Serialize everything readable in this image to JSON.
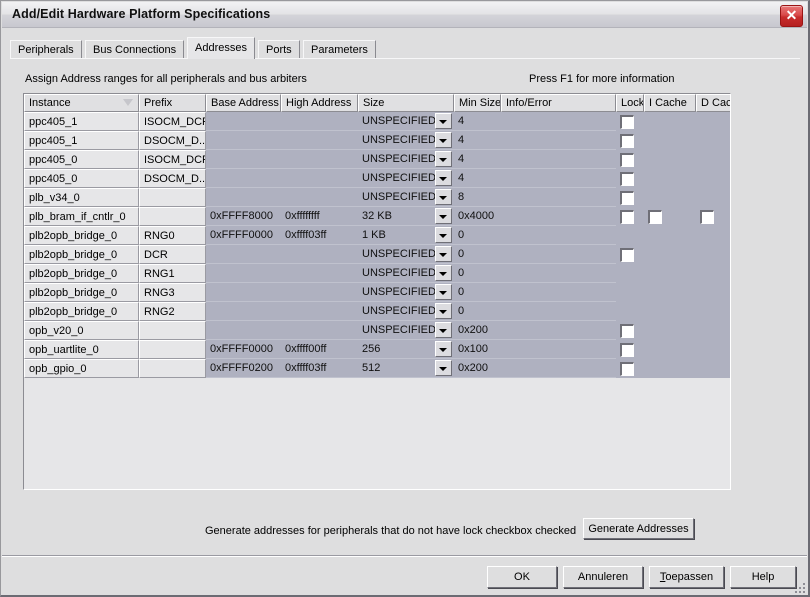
{
  "window": {
    "title": "Add/Edit Hardware Platform Specifications",
    "close_icon": "close-icon",
    "close_glyph": "✕"
  },
  "tabs": [
    {
      "label": "Peripherals",
      "selected": false
    },
    {
      "label": "Bus Connections",
      "selected": false
    },
    {
      "label": "Addresses",
      "selected": true
    },
    {
      "label": "Ports",
      "selected": false
    },
    {
      "label": "Parameters",
      "selected": false
    }
  ],
  "panel": {
    "assign_label": "Assign Address ranges for all peripherals and bus arbiters",
    "help_hint": "Press F1 for more information"
  },
  "table": {
    "columns": [
      {
        "label": "Instance",
        "sorted": true
      },
      {
        "label": "Prefix",
        "sorted": false
      },
      {
        "label": "Base Address",
        "sorted": false
      },
      {
        "label": "High Address",
        "sorted": false
      },
      {
        "label": "Size",
        "sorted": false
      },
      {
        "label": "Min Size",
        "sorted": false
      },
      {
        "label": "Info/Error",
        "sorted": false
      },
      {
        "label": "Lock",
        "sorted": false
      },
      {
        "label": "I Cache",
        "sorted": false
      },
      {
        "label": "D Cache",
        "sorted": false
      }
    ],
    "rows": [
      {
        "instance": "ppc405_1",
        "prefix": "ISOCM_DCR",
        "base": "",
        "high": "",
        "size": "UNSPECIFIED",
        "min_size": "4",
        "info": "",
        "lock": true,
        "icache": false,
        "dcache": false
      },
      {
        "instance": "ppc405_1",
        "prefix": "DSOCM_D...",
        "base": "",
        "high": "",
        "size": "UNSPECIFIED",
        "min_size": "4",
        "info": "",
        "lock": true,
        "icache": false,
        "dcache": false
      },
      {
        "instance": "ppc405_0",
        "prefix": "ISOCM_DCR",
        "base": "",
        "high": "",
        "size": "UNSPECIFIED",
        "min_size": "4",
        "info": "",
        "lock": true,
        "icache": false,
        "dcache": false
      },
      {
        "instance": "ppc405_0",
        "prefix": "DSOCM_D...",
        "base": "",
        "high": "",
        "size": "UNSPECIFIED",
        "min_size": "4",
        "info": "",
        "lock": true,
        "icache": false,
        "dcache": false
      },
      {
        "instance": "plb_v34_0",
        "prefix": "",
        "base": "",
        "high": "",
        "size": "UNSPECIFIED",
        "min_size": "8",
        "info": "",
        "lock": true,
        "icache": false,
        "dcache": false
      },
      {
        "instance": "plb_bram_if_cntlr_0",
        "prefix": "",
        "base": "0xFFFF8000",
        "high": "0xffffffff",
        "size": "32 KB",
        "min_size": "0x4000",
        "info": "",
        "lock": true,
        "icache": true,
        "dcache": true
      },
      {
        "instance": "plb2opb_bridge_0",
        "prefix": "RNG0",
        "base": "0xFFFF0000",
        "high": "0xffff03ff",
        "size": "1 KB",
        "min_size": "0",
        "info": "",
        "lock": false,
        "icache": false,
        "dcache": false
      },
      {
        "instance": "plb2opb_bridge_0",
        "prefix": "DCR",
        "base": "",
        "high": "",
        "size": "UNSPECIFIED",
        "min_size": "0",
        "info": "",
        "lock": true,
        "icache": false,
        "dcache": false
      },
      {
        "instance": "plb2opb_bridge_0",
        "prefix": "RNG1",
        "base": "",
        "high": "",
        "size": "UNSPECIFIED",
        "min_size": "0",
        "info": "",
        "lock": false,
        "icache": false,
        "dcache": false
      },
      {
        "instance": "plb2opb_bridge_0",
        "prefix": "RNG3",
        "base": "",
        "high": "",
        "size": "UNSPECIFIED",
        "min_size": "0",
        "info": "",
        "lock": false,
        "icache": false,
        "dcache": false
      },
      {
        "instance": "plb2opb_bridge_0",
        "prefix": "RNG2",
        "base": "",
        "high": "",
        "size": "UNSPECIFIED",
        "min_size": "0",
        "info": "",
        "lock": false,
        "icache": false,
        "dcache": false
      },
      {
        "instance": "opb_v20_0",
        "prefix": "",
        "base": "",
        "high": "",
        "size": "UNSPECIFIED",
        "min_size": "0x200",
        "info": "",
        "lock": true,
        "icache": false,
        "dcache": false
      },
      {
        "instance": "opb_uartlite_0",
        "prefix": "",
        "base": "0xFFFF0000",
        "high": "0xffff00ff",
        "size": "256",
        "min_size": "0x100",
        "info": "",
        "lock": true,
        "icache": false,
        "dcache": false
      },
      {
        "instance": "opb_gpio_0",
        "prefix": "",
        "base": "0xFFFF0200",
        "high": "0xffff03ff",
        "size": "512",
        "min_size": "0x200",
        "info": "",
        "lock": true,
        "icache": false,
        "dcache": false
      }
    ]
  },
  "generate": {
    "label": "Generate addresses for peripherals that do not have lock checkbox checked",
    "button_label": "Generate Addresses"
  },
  "footer": {
    "ok": "OK",
    "cancel": "Annuleren",
    "apply_prefix": "T",
    "apply_rest": "oepassen",
    "help": "Help"
  },
  "colors": {
    "window_bg": "#dededf",
    "grid_bg": "#afb1c0",
    "header_bg": "#e0e0e2",
    "close_red": "#c82c2c"
  }
}
